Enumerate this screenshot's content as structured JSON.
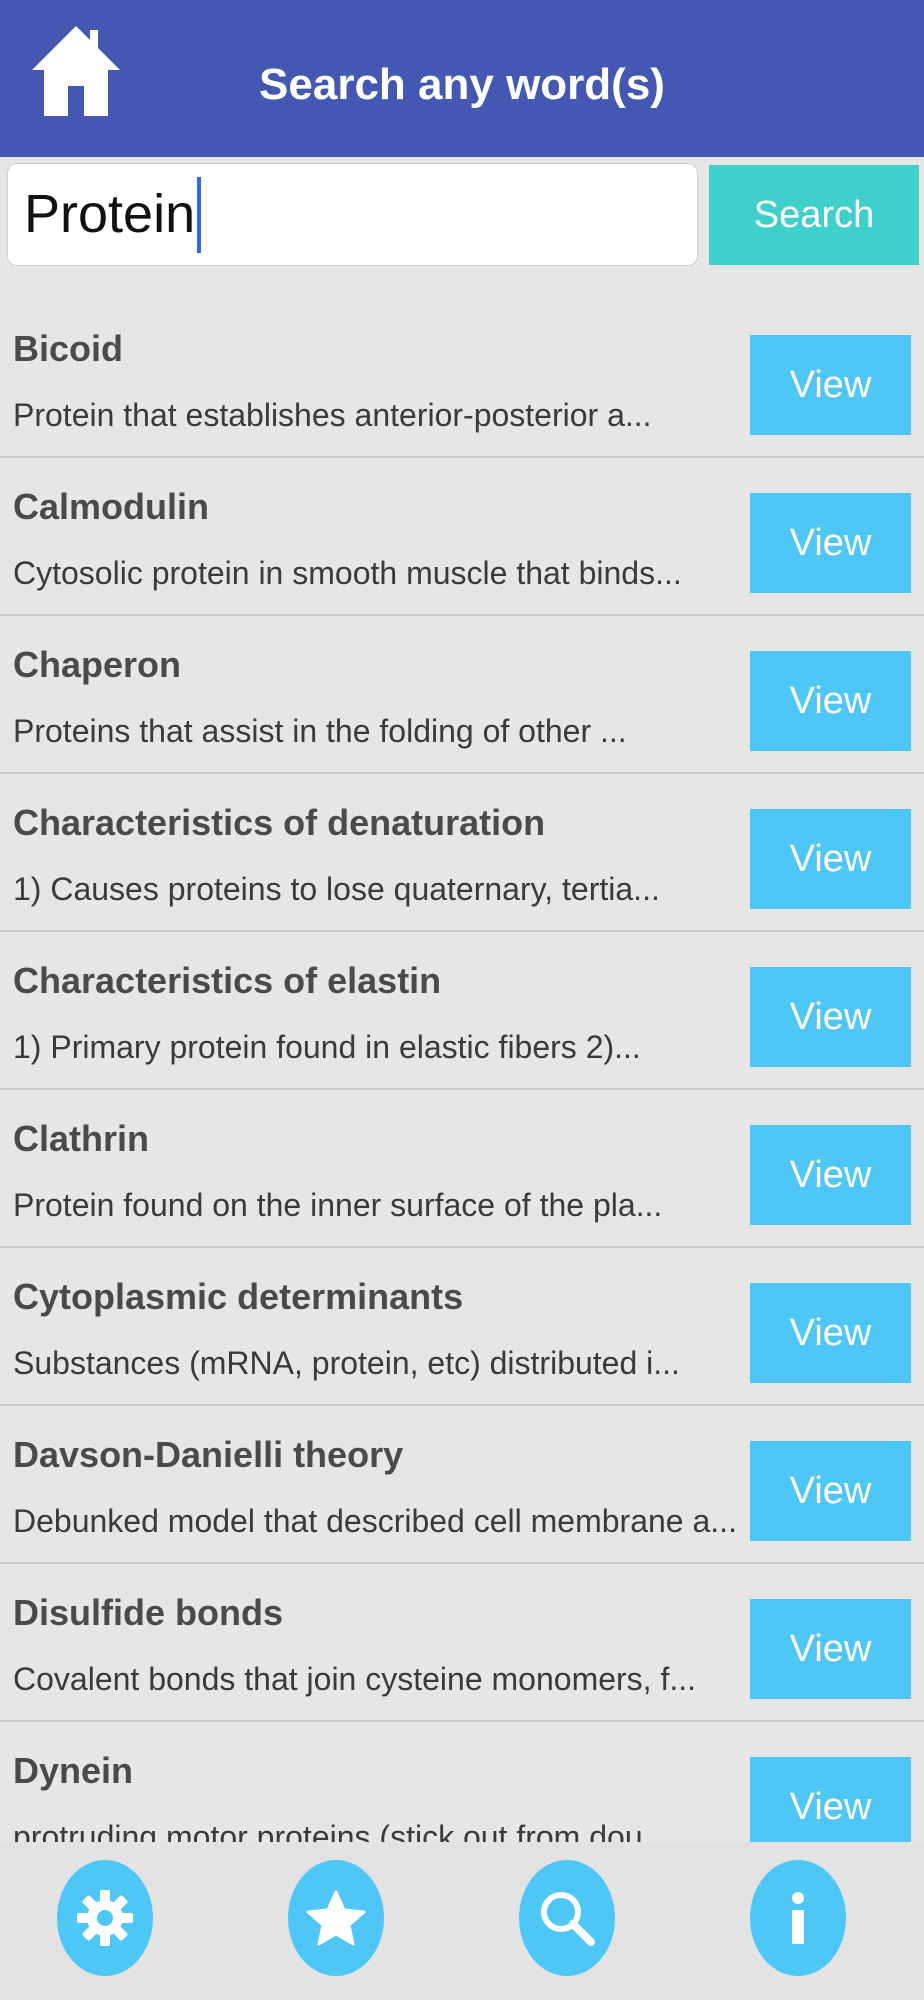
{
  "header": {
    "title": "Search any word(s)",
    "home_icon": "home-icon",
    "background_color": "#4357b3"
  },
  "search": {
    "value": "Protein",
    "button_label": "Search",
    "button_color": "#3fd0cc"
  },
  "results": [
    {
      "title": "Bicoid",
      "description": "Protein that establishes anterior-posterior a...",
      "button_label": "View"
    },
    {
      "title": "Calmodulin",
      "description": "Cytosolic protein in smooth muscle that binds...",
      "button_label": "View"
    },
    {
      "title": "Chaperon",
      "description": "Proteins that assist in the folding of other ...",
      "button_label": "View"
    },
    {
      "title": "Characteristics of denaturation",
      "description": "1) Causes proteins to lose quaternary, tertia...",
      "button_label": "View"
    },
    {
      "title": "Characteristics of elastin",
      "description": "1) Primary protein found in elastic fibers 2)...",
      "button_label": "View"
    },
    {
      "title": "Clathrin",
      "description": "Protein found on the inner surface of the pla...",
      "button_label": "View"
    },
    {
      "title": "Cytoplasmic determinants",
      "description": "Substances (mRNA, protein, etc) distributed i...",
      "button_label": "View"
    },
    {
      "title": "Davson-Danielli theory",
      "description": "Debunked model that described cell membrane a...",
      "button_label": "View"
    },
    {
      "title": "Disulfide bonds",
      "description": "Covalent bonds that join cysteine monomers, f...",
      "button_label": "View"
    },
    {
      "title": "Dynein",
      "description": "protruding motor proteins (stick out from dou...",
      "button_label": "View"
    }
  ],
  "view_button_color": "#4ec6f6",
  "tabbar": {
    "items": [
      {
        "icon": "gear-icon"
      },
      {
        "icon": "star-icon"
      },
      {
        "icon": "search-icon"
      },
      {
        "icon": "info-icon"
      }
    ]
  }
}
